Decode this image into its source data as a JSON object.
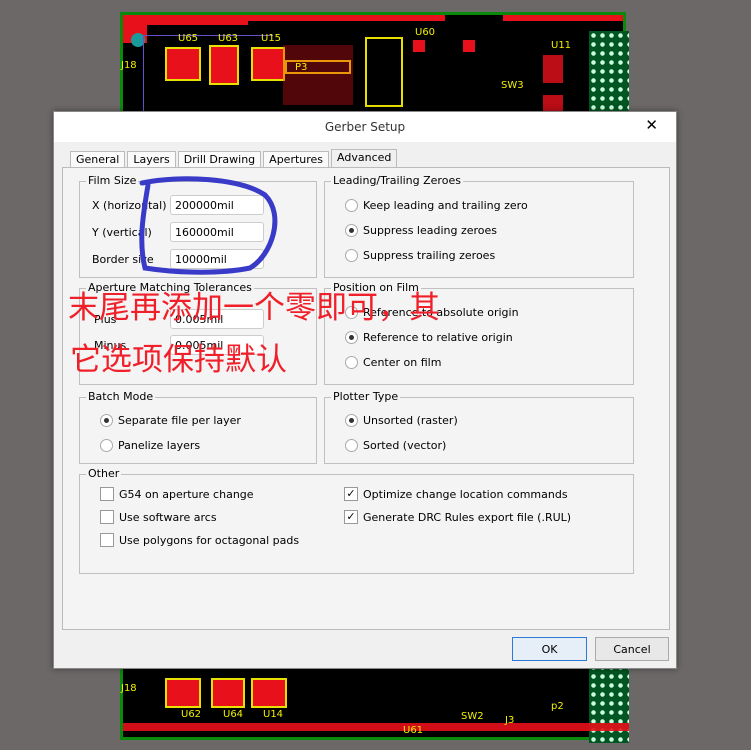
{
  "background_pcb": {
    "top_labels": [
      "U65",
      "U63",
      "U15",
      "U60",
      "J18",
      "P3",
      "SW3",
      "U11"
    ],
    "bottom_labels": [
      "J18",
      "U62",
      "U64",
      "U14",
      "U61",
      "SW2",
      "J3",
      "p2"
    ]
  },
  "dialog": {
    "title": "Gerber Setup",
    "close_icon": "close-icon",
    "tabs": [
      {
        "label": "General",
        "active": false
      },
      {
        "label": "Layers",
        "active": false
      },
      {
        "label": "Drill Drawing",
        "active": false
      },
      {
        "label": "Apertures",
        "active": false
      },
      {
        "label": "Advanced",
        "active": true
      }
    ],
    "film_size": {
      "title": "Film Size",
      "x_label": "X (horizontal)",
      "x_value": "200000mil",
      "y_label": "Y (vertical)",
      "y_value": "160000mil",
      "border_label": "Border size",
      "border_value": "10000mil"
    },
    "aperture": {
      "title": "Aperture Matching Tolerances",
      "plus_label": "Plus",
      "plus_value": "0.005mil",
      "minus_label": "Minus",
      "minus_value": "0.005mil"
    },
    "batch": {
      "title": "Batch Mode",
      "options": [
        {
          "label": "Separate file per layer",
          "selected": true
        },
        {
          "label": "Panelize layers",
          "selected": false
        }
      ]
    },
    "zeroes": {
      "title": "Leading/Trailing Zeroes",
      "options": [
        {
          "label": "Keep leading and trailing zero",
          "selected": false
        },
        {
          "label": "Suppress leading zeroes",
          "selected": true
        },
        {
          "label": "Suppress trailing zeroes",
          "selected": false
        }
      ]
    },
    "position": {
      "title": "Position on Film",
      "options": [
        {
          "label": "Reference to absolute origin",
          "selected": false
        },
        {
          "label": "Reference to relative origin",
          "selected": true
        },
        {
          "label": "Center on film",
          "selected": false
        }
      ]
    },
    "plotter": {
      "title": "Plotter Type",
      "options": [
        {
          "label": "Unsorted (raster)",
          "selected": true
        },
        {
          "label": "Sorted (vector)",
          "selected": false
        }
      ]
    },
    "other": {
      "title": "Other",
      "checks": [
        {
          "label": "G54 on aperture change",
          "checked": false
        },
        {
          "label": "Use software arcs",
          "checked": false
        },
        {
          "label": "Use polygons for octagonal pads",
          "checked": false
        },
        {
          "label": "Optimize change location commands",
          "checked": true
        },
        {
          "label": "Generate DRC Rules export file (.RUL)",
          "checked": true
        }
      ]
    },
    "ok_label": "OK",
    "cancel_label": "Cancel"
  },
  "annotation": {
    "line1": "末尾再添加一个零即可，其",
    "line2": "它选项保持默认",
    "color": "#f0202a",
    "scribble_color": "#3a3ac8"
  }
}
